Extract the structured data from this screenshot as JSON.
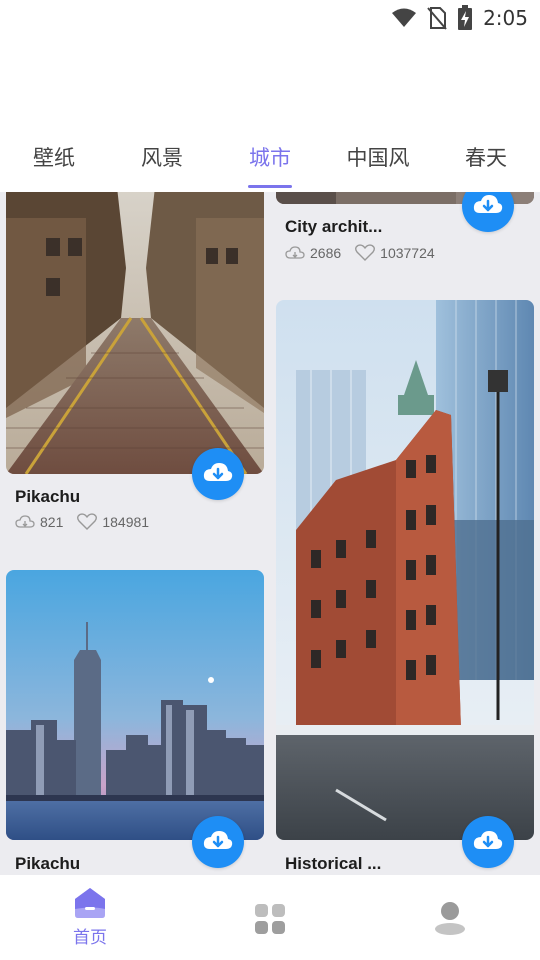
{
  "status_bar": {
    "time": "2:05",
    "icons": [
      "wifi-icon",
      "no-sim-icon",
      "battery-charging-icon"
    ]
  },
  "tabs": [
    {
      "label": "壁纸",
      "active": false
    },
    {
      "label": "风景",
      "active": false
    },
    {
      "label": "城市",
      "active": true
    },
    {
      "label": "中国风",
      "active": false
    },
    {
      "label": "春天",
      "active": false
    }
  ],
  "cards": {
    "left_1": {
      "title": "Pikachu",
      "downloads": "821",
      "likes": "184981",
      "image": "cobblestone-street"
    },
    "left_2": {
      "title": "Pikachu",
      "image": "city-skyline-dusk"
    },
    "right_1": {
      "title": "City archit...",
      "downloads": "2686",
      "likes": "1037724",
      "image": "city-architecture"
    },
    "right_2": {
      "title": "Historical ...",
      "image": "flatiron-building"
    }
  },
  "bottom_nav": {
    "home_label": "首页",
    "items": [
      "home-icon",
      "categories-icon",
      "profile-icon"
    ]
  },
  "colors": {
    "accent": "#7b74ec",
    "download_button": "#1e8ef5",
    "feed_background": "#ececf0"
  }
}
